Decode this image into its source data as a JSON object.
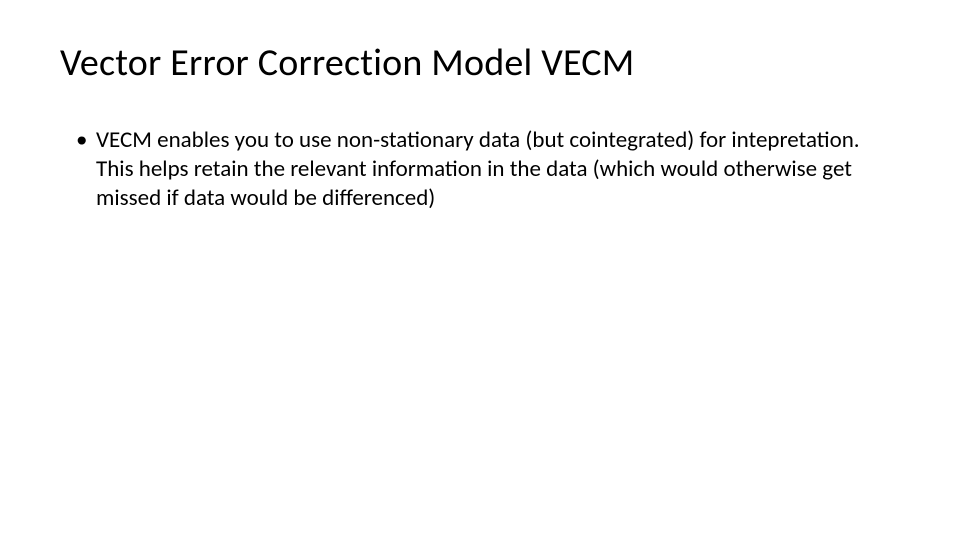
{
  "title": "Vector Error Correction Model VECM",
  "bullets": [
    "VECM enables you to use non-stationary data (but cointegrated) for intepretation. This helps retain the relevant information in the data (which would otherwise get missed if data would be differenced)"
  ]
}
